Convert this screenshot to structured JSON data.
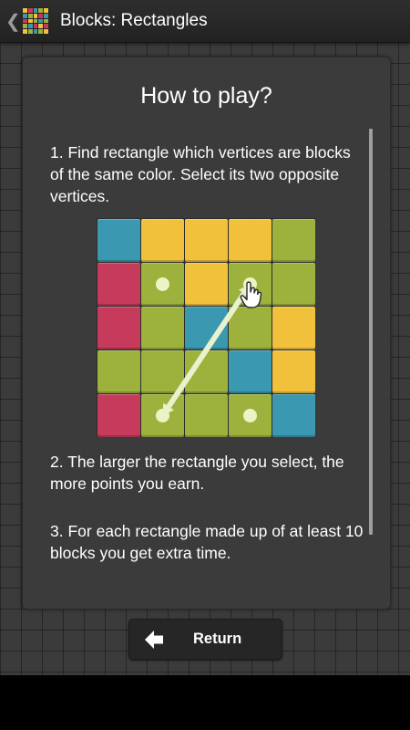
{
  "action_bar": {
    "title": "Blocks: Rectangles",
    "back_icon": "chevron-left-icon",
    "app_icon": "colored-grid-app-icon"
  },
  "help_panel": {
    "title": "How to play?",
    "step1": "1. Find rectangle which vertices are blocks of the same color. Select its two opposite vertices.",
    "step2": "2. The larger the rectangle you select, the more points you earn.",
    "step3": "3. For each rectangle made up of at least 10 blocks you get extra time."
  },
  "example_board": {
    "colors": {
      "B": "#3a98b0",
      "Y": "#f2c13c",
      "G": "#9cb23c",
      "R": "#c63a5c"
    },
    "rows": [
      [
        "B",
        "Y",
        "Y",
        "Y",
        "G"
      ],
      [
        "R",
        "G",
        "Y",
        "G",
        "G"
      ],
      [
        "R",
        "G",
        "B",
        "G",
        "Y"
      ],
      [
        "G",
        "G",
        "G",
        "B",
        "Y"
      ],
      [
        "R",
        "G",
        "G",
        "G",
        "B"
      ]
    ],
    "selected": [
      [
        1,
        1
      ],
      [
        1,
        3
      ],
      [
        4,
        1
      ],
      [
        4,
        3
      ]
    ],
    "arrow_from": [
      4,
      1
    ],
    "arrow_to": [
      1,
      3
    ],
    "pointer_icon": "hand-pointer-icon"
  },
  "footer": {
    "return_label": "Return",
    "return_icon": "arrow-left-icon"
  }
}
